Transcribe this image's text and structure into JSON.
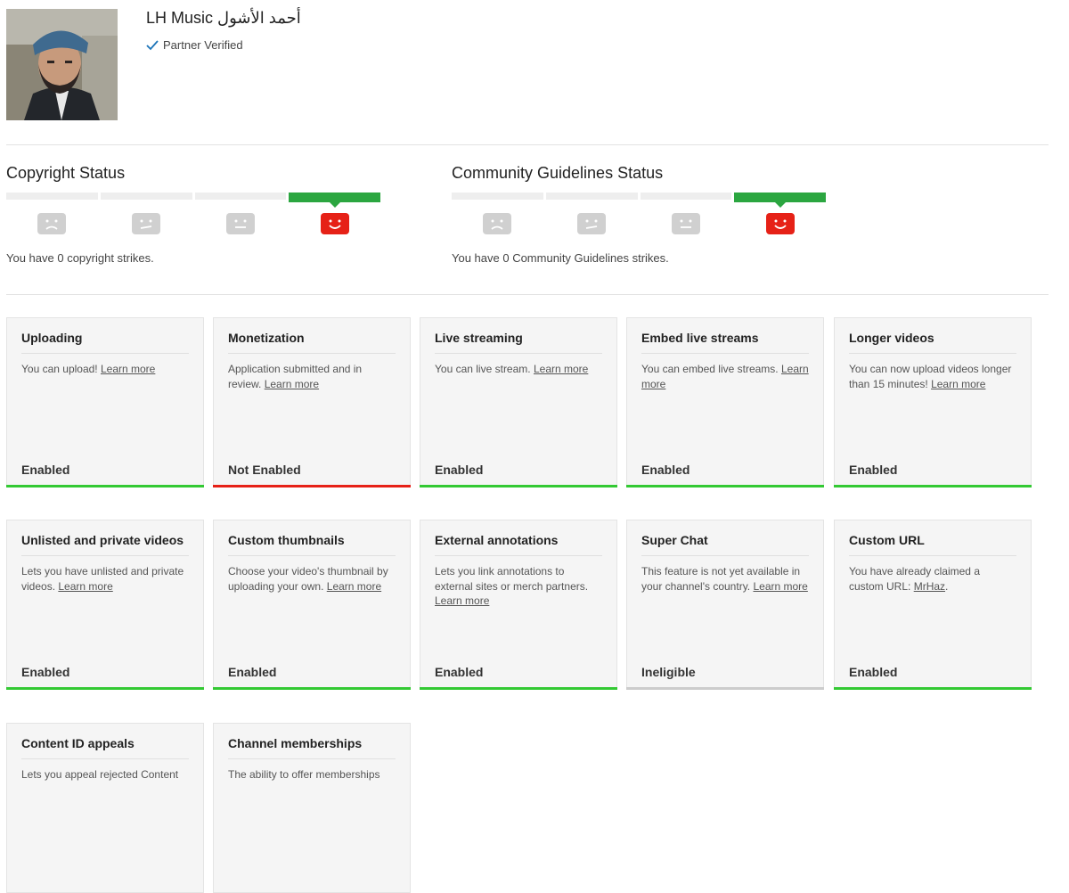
{
  "channel": {
    "name": "LH Music أحمد الأشول",
    "verified_label": "Partner Verified"
  },
  "copyright": {
    "title": "Copyright Status",
    "active_segment": 4,
    "text": "You have 0 copyright strikes."
  },
  "community": {
    "title": "Community Guidelines Status",
    "active_segment": 4,
    "text": "You have 0 Community Guidelines strikes."
  },
  "colors": {
    "enabled": "#33c933",
    "not_enabled": "#e62117",
    "ineligible": "#cccccc",
    "active_face": "#e62117",
    "status_green": "#2ba640"
  },
  "features": [
    {
      "title": "Uploading",
      "desc": "You can upload!",
      "link": "Learn more",
      "state": "Enabled",
      "status": "enabled"
    },
    {
      "title": "Monetization",
      "desc": "Application submitted and in review.",
      "link": "Learn more",
      "state": "Not Enabled",
      "status": "not_enabled"
    },
    {
      "title": "Live streaming",
      "desc": "You can live stream.",
      "link": "Learn more",
      "state": "Enabled",
      "status": "enabled"
    },
    {
      "title": "Embed live streams",
      "desc": "You can embed live streams.",
      "link": "Learn more",
      "state": "Enabled",
      "status": "enabled"
    },
    {
      "title": "Longer videos",
      "desc": "You can now upload videos longer than 15 minutes!",
      "link": "Learn more",
      "state": "Enabled",
      "status": "enabled"
    },
    {
      "title": "Unlisted and private videos",
      "desc": "Lets you have unlisted and private videos.",
      "link": "Learn more",
      "state": "Enabled",
      "status": "enabled"
    },
    {
      "title": "Custom thumbnails",
      "desc": "Choose your video's thumbnail by uploading your own.",
      "link": "Learn more",
      "state": "Enabled",
      "status": "enabled"
    },
    {
      "title": "External annotations",
      "desc": "Lets you link annotations to external sites or merch partners.",
      "link": "Learn more",
      "state": "Enabled",
      "status": "enabled"
    },
    {
      "title": "Super Chat",
      "desc": "This feature is not yet available in your channel's country.",
      "link": "Learn more",
      "state": "Ineligible",
      "status": "ineligible"
    },
    {
      "title": "Custom URL",
      "desc": "You have already claimed a custom URL:",
      "link": "MrHaz",
      "desc_suffix": ".",
      "state": "Enabled",
      "status": "enabled"
    },
    {
      "title": "Content ID appeals",
      "desc": "Lets you appeal rejected Content",
      "link": "",
      "state": "",
      "status": "none"
    },
    {
      "title": "Channel memberships",
      "desc": "The ability to offer memberships",
      "link": "",
      "state": "",
      "status": "none"
    }
  ]
}
